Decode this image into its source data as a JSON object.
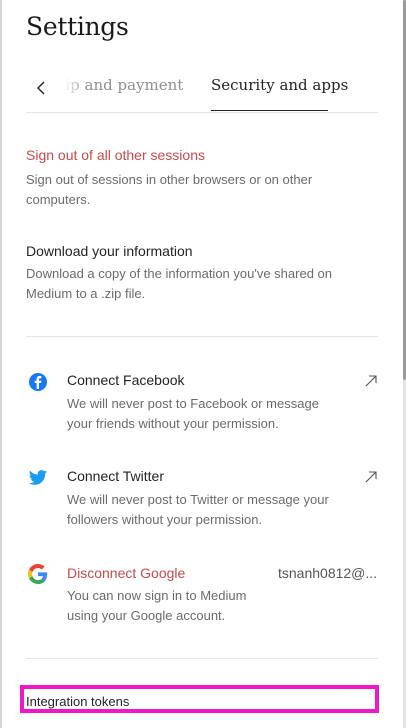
{
  "page": {
    "title": "Settings"
  },
  "tabs": {
    "previous": "ship and payment",
    "active": "Security and apps"
  },
  "sessions": {
    "link": "Sign out of all other sessions",
    "desc_line1": "Sign out of sessions in other browsers or on other",
    "desc_line2": "computers."
  },
  "download": {
    "title": "Download your information",
    "desc_line1": "Download a copy of the information you've shared on",
    "desc_line2": "Medium to a .zip file."
  },
  "connections": {
    "facebook": {
      "title": "Connect Facebook",
      "desc_line1": "We will never post to Facebook or message",
      "desc_line2": "your friends without your permission."
    },
    "twitter": {
      "title": "Connect Twitter",
      "desc_line1": "We will never post to Twitter or message your",
      "desc_line2": "followers without your permission."
    },
    "google": {
      "title": "Disconnect Google",
      "account": "tsnanh0812@...",
      "desc_line1": "You can now sign in to Medium",
      "desc_line2": "using your Google account."
    }
  },
  "integration": {
    "title": "Integration tokens"
  },
  "colors": {
    "danger": "#c94a4a",
    "facebook": "#1877f2",
    "twitter": "#1d9bf0",
    "highlight": "#ee18c8"
  },
  "icons": [
    "chevron-left-icon",
    "facebook-icon",
    "twitter-icon",
    "google-icon",
    "external-arrow-icon"
  ]
}
